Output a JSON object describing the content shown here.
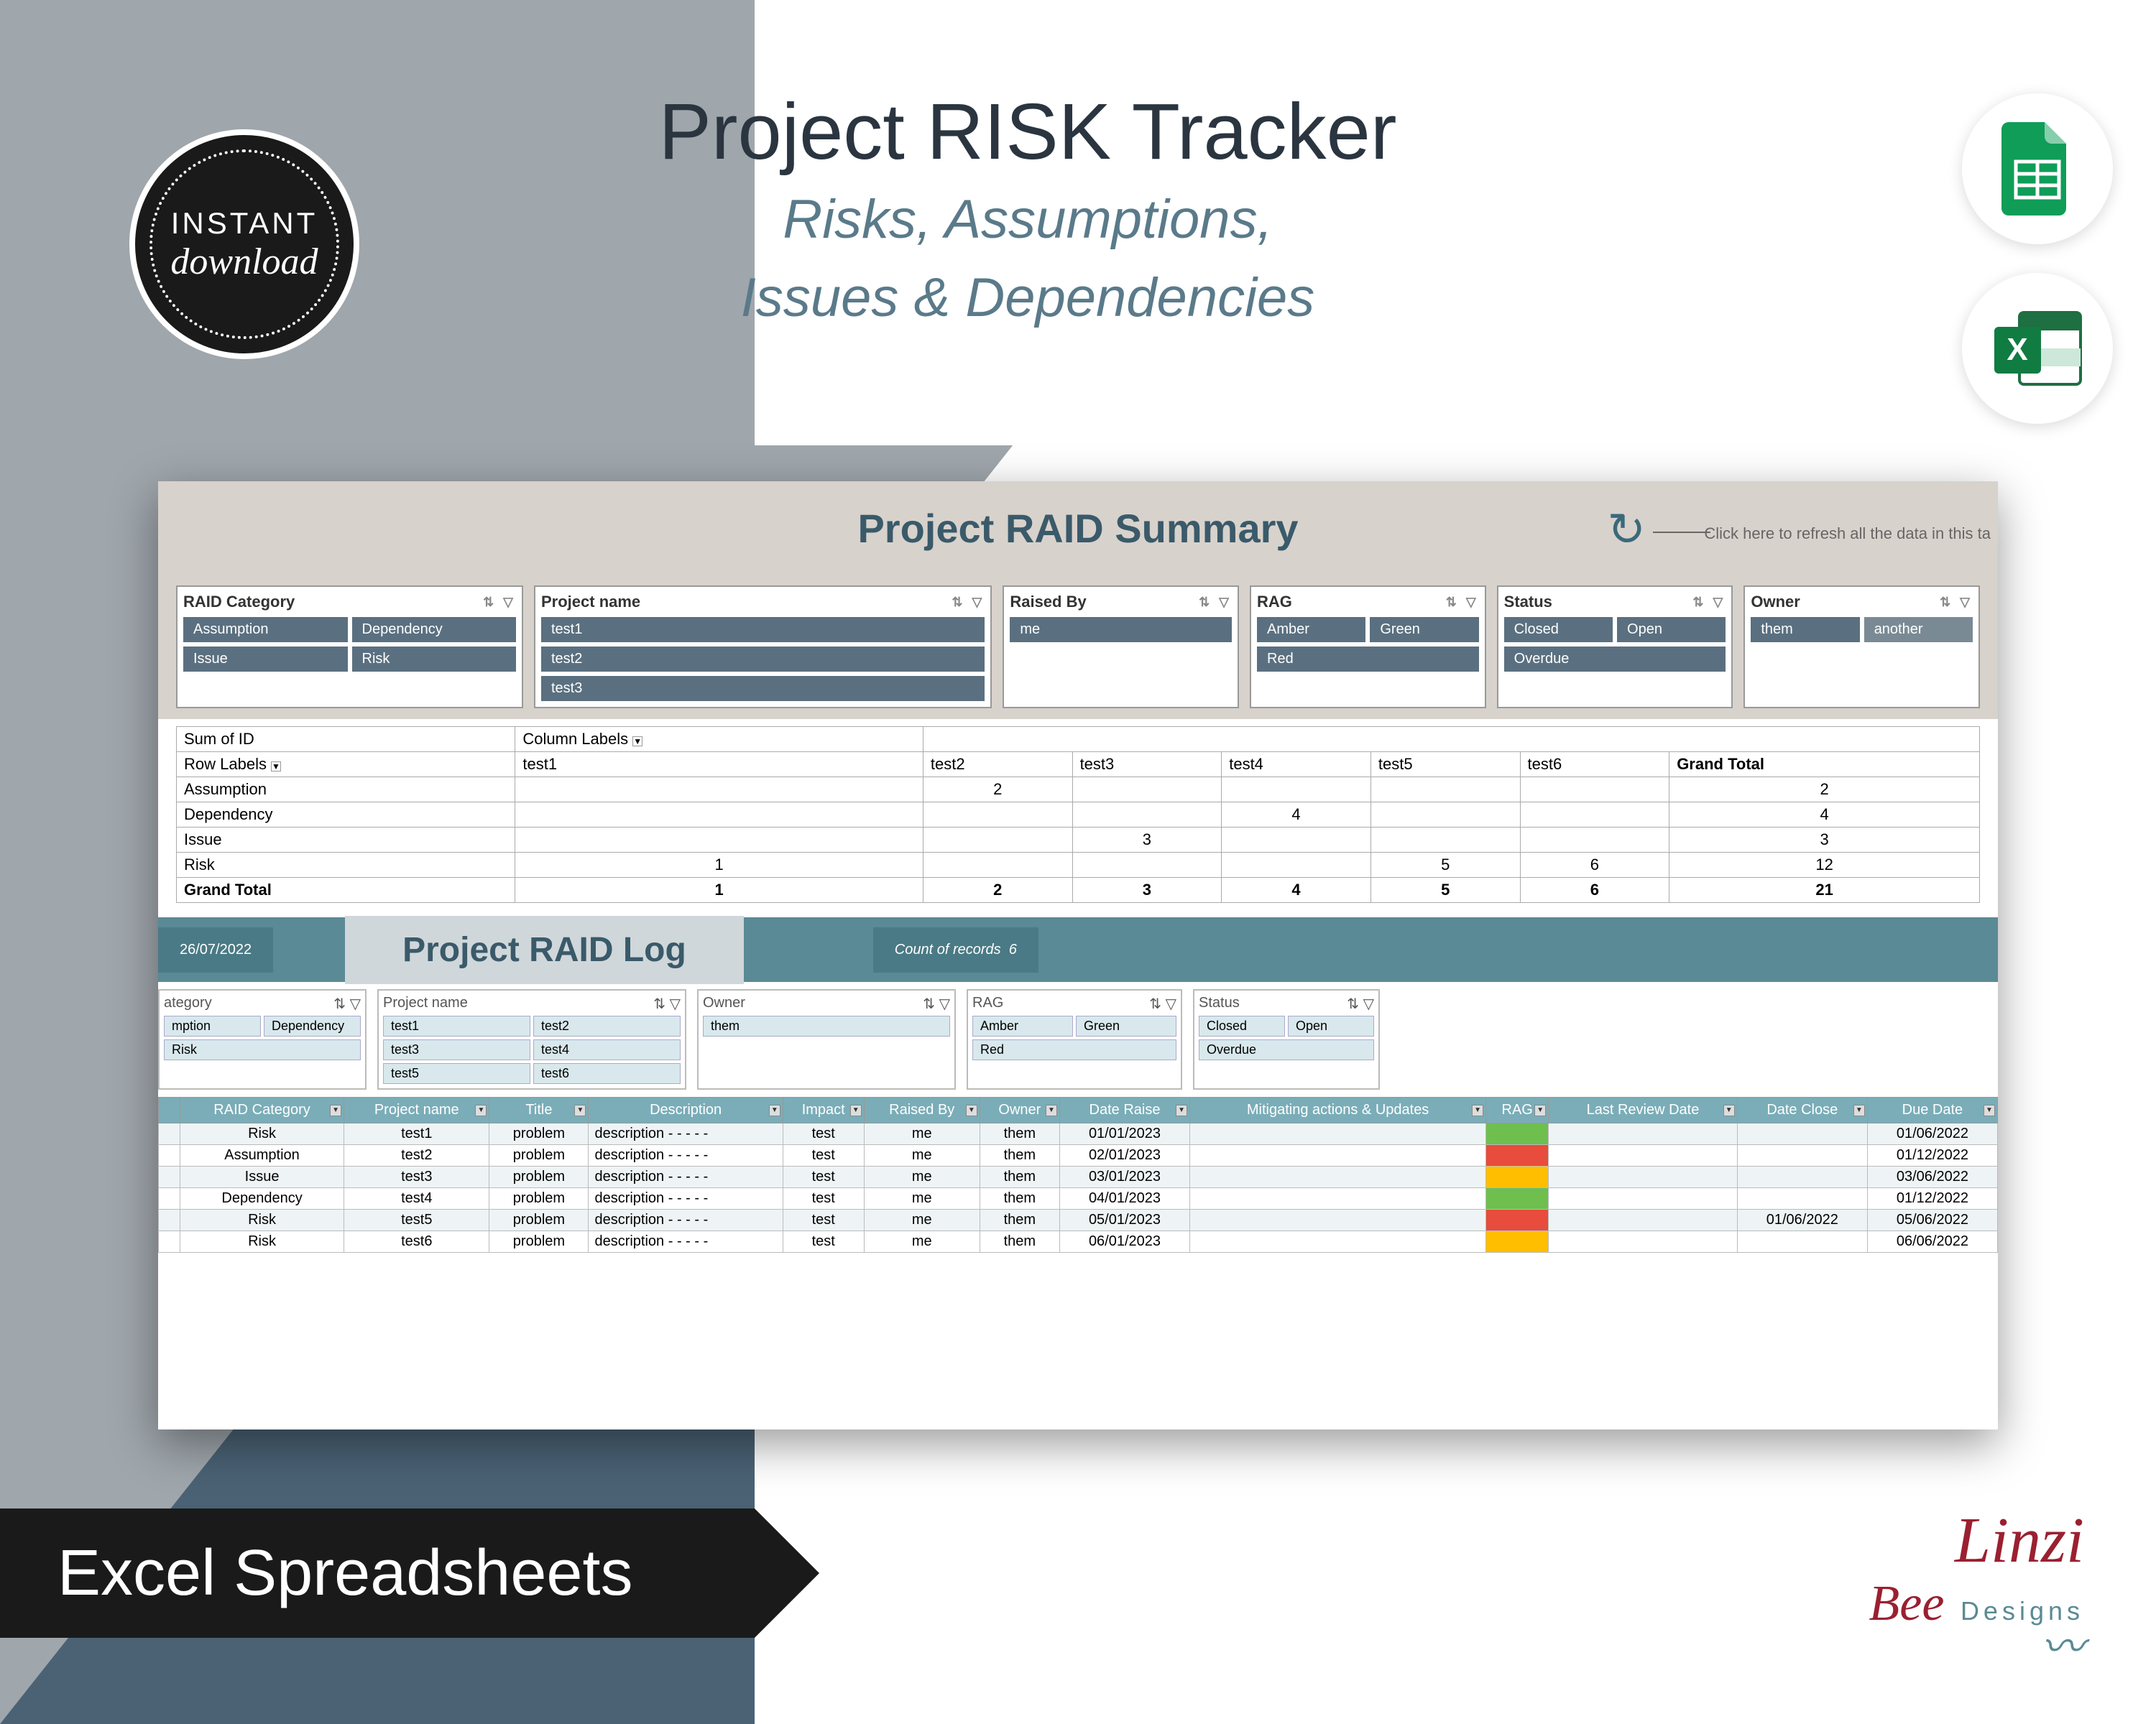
{
  "badge": {
    "line1": "INSTANT",
    "line2": "download"
  },
  "title": {
    "main": "Project RISK Tracker",
    "sub1": "Risks, Assumptions,",
    "sub2": "Issues & Dependencies"
  },
  "summary": {
    "heading": "Project RAID Summary",
    "hint": "Click here to refresh all the data in this ta",
    "slicers": {
      "cat": {
        "label": "RAID Category",
        "items": [
          "Assumption",
          "Dependency",
          "Issue",
          "Risk"
        ]
      },
      "proj": {
        "label": "Project name",
        "items": [
          "test1",
          "test2",
          "test3"
        ]
      },
      "raised": {
        "label": "Raised By",
        "items": [
          "me"
        ]
      },
      "rag": {
        "label": "RAG",
        "items": [
          "Amber",
          "Green",
          "Red"
        ]
      },
      "status": {
        "label": "Status",
        "items": [
          "Closed",
          "Open",
          "Overdue"
        ]
      },
      "owner": {
        "label": "Owner",
        "items": [
          "them",
          "another"
        ]
      }
    },
    "pivot": {
      "sumof": "Sum of ID",
      "collab": "Column Labels",
      "rowlab": "Row Labels",
      "cols": [
        "test1",
        "test2",
        "test3",
        "test4",
        "test5",
        "test6",
        "Grand Total"
      ],
      "rows": [
        {
          "label": "Assumption",
          "v": [
            "",
            "2",
            "",
            "",
            "",
            "",
            "2"
          ]
        },
        {
          "label": "Dependency",
          "v": [
            "",
            "",
            "",
            "4",
            "",
            "",
            "4"
          ]
        },
        {
          "label": "Issue",
          "v": [
            "",
            "",
            "3",
            "",
            "",
            "",
            "3"
          ]
        },
        {
          "label": "Risk",
          "v": [
            "1",
            "",
            "",
            "",
            "5",
            "6",
            "12"
          ]
        },
        {
          "label": "Grand Total",
          "v": [
            "1",
            "2",
            "3",
            "4",
            "5",
            "6",
            "21"
          ]
        }
      ]
    }
  },
  "log": {
    "date": "26/07/2022",
    "heading": "Project RAID Log",
    "count_label": "Count of records",
    "count_val": "6",
    "slicers": {
      "cat": {
        "label": "ategory",
        "items": [
          "mption",
          "Dependency",
          "Risk"
        ]
      },
      "proj": {
        "label": "Project name",
        "items": [
          "test1",
          "test2",
          "test3",
          "test4",
          "test5",
          "test6"
        ]
      },
      "owner": {
        "label": "Owner",
        "items": [
          "them"
        ]
      },
      "rag": {
        "label": "RAG",
        "items": [
          "Amber",
          "Green",
          "Red"
        ]
      },
      "status": {
        "label": "Status",
        "items": [
          "Closed",
          "Open",
          "Overdue"
        ]
      }
    },
    "columns": [
      "RAID Category",
      "Project name",
      "Title",
      "Description",
      "Impact",
      "Raised By",
      "Owner",
      "Date Raise",
      "Mitigating actions & Updates",
      "RAG",
      "Last Review Date",
      "Date Close",
      "Due Date"
    ],
    "rows": [
      {
        "cat": "Risk",
        "proj": "test1",
        "title": "problem",
        "desc": "description - - - - -",
        "impact": "test",
        "rb": "me",
        "ow": "them",
        "dr": "01/01/2023",
        "mit": "",
        "rag": "g",
        "lrd": "",
        "dc": "",
        "dd": "01/06/2022"
      },
      {
        "cat": "Assumption",
        "proj": "test2",
        "title": "problem",
        "desc": "description - - - - -",
        "impact": "test",
        "rb": "me",
        "ow": "them",
        "dr": "02/01/2023",
        "mit": "",
        "rag": "r",
        "lrd": "",
        "dc": "",
        "dd": "01/12/2022"
      },
      {
        "cat": "Issue",
        "proj": "test3",
        "title": "problem",
        "desc": "description - - - - -",
        "impact": "test",
        "rb": "me",
        "ow": "them",
        "dr": "03/01/2023",
        "mit": "",
        "rag": "a",
        "lrd": "",
        "dc": "",
        "dd": "03/06/2022"
      },
      {
        "cat": "Dependency",
        "proj": "test4",
        "title": "problem",
        "desc": "description - - - - -",
        "impact": "test",
        "rb": "me",
        "ow": "them",
        "dr": "04/01/2023",
        "mit": "",
        "rag": "g",
        "lrd": "",
        "dc": "",
        "dd": "01/12/2022"
      },
      {
        "cat": "Risk",
        "proj": "test5",
        "title": "problem",
        "desc": "description - - - - -",
        "impact": "test",
        "rb": "me",
        "ow": "them",
        "dr": "05/01/2023",
        "mit": "",
        "rag": "r",
        "lrd": "",
        "dc": "01/06/2022",
        "dd": "05/06/2022"
      },
      {
        "cat": "Risk",
        "proj": "test6",
        "title": "problem",
        "desc": "description - - - - -",
        "impact": "test",
        "rb": "me",
        "ow": "them",
        "dr": "06/01/2023",
        "mit": "",
        "rag": "a",
        "lrd": "",
        "dc": "",
        "dd": "06/06/2022"
      }
    ]
  },
  "footer": {
    "label": "Excel Spreadsheets"
  },
  "brand": {
    "l1": "Linzi",
    "l2": "Bee",
    "l3": "Designs"
  }
}
